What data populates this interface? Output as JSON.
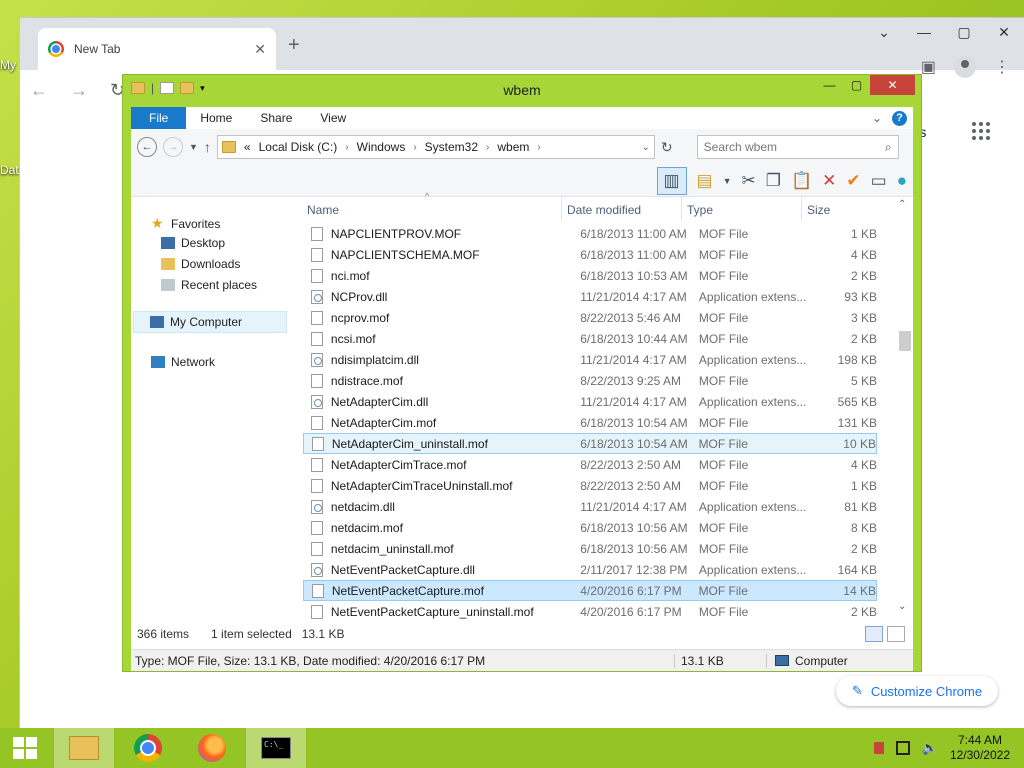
{
  "desktop": {
    "label1": "My",
    "label2": "Dat"
  },
  "chrome": {
    "tab_title": "New Tab",
    "page_text_partial": "ages",
    "customize_label": "Customize Chrome"
  },
  "explorer": {
    "title": "wbem",
    "ribbon_tabs": [
      "File",
      "Home",
      "Share",
      "View"
    ],
    "breadcrumb": [
      "«",
      "Local Disk (C:)",
      "Windows",
      "System32",
      "wbem"
    ],
    "search_placeholder": "Search wbem",
    "nav": {
      "favorites": "Favorites",
      "desktop": "Desktop",
      "downloads": "Downloads",
      "recent": "Recent places",
      "computer": "My Computer",
      "network": "Network"
    },
    "columns": {
      "name": "Name",
      "date": "Date modified",
      "type": "Type",
      "size": "Size"
    },
    "files": [
      {
        "name": "NAPCLIENTPROV.MOF",
        "date": "6/18/2013 11:00 AM",
        "type": "MOF File",
        "size": "1 KB",
        "kind": "mof"
      },
      {
        "name": "NAPCLIENTSCHEMA.MOF",
        "date": "6/18/2013 11:00 AM",
        "type": "MOF File",
        "size": "4 KB",
        "kind": "mof"
      },
      {
        "name": "nci.mof",
        "date": "6/18/2013 10:53 AM",
        "type": "MOF File",
        "size": "2 KB",
        "kind": "mof"
      },
      {
        "name": "NCProv.dll",
        "date": "11/21/2014 4:17 AM",
        "type": "Application extens...",
        "size": "93 KB",
        "kind": "dll"
      },
      {
        "name": "ncprov.mof",
        "date": "8/22/2013 5:46 AM",
        "type": "MOF File",
        "size": "3 KB",
        "kind": "mof"
      },
      {
        "name": "ncsi.mof",
        "date": "6/18/2013 10:44 AM",
        "type": "MOF File",
        "size": "2 KB",
        "kind": "mof"
      },
      {
        "name": "ndisimplatcim.dll",
        "date": "11/21/2014 4:17 AM",
        "type": "Application extens...",
        "size": "198 KB",
        "kind": "dll"
      },
      {
        "name": "ndistrace.mof",
        "date": "8/22/2013 9:25 AM",
        "type": "MOF File",
        "size": "5 KB",
        "kind": "mof"
      },
      {
        "name": "NetAdapterCim.dll",
        "date": "11/21/2014 4:17 AM",
        "type": "Application extens...",
        "size": "565 KB",
        "kind": "dll"
      },
      {
        "name": "NetAdapterCim.mof",
        "date": "6/18/2013 10:54 AM",
        "type": "MOF File",
        "size": "131 KB",
        "kind": "mof"
      },
      {
        "name": "NetAdapterCim_uninstall.mof",
        "date": "6/18/2013 10:54 AM",
        "type": "MOF File",
        "size": "10 KB",
        "kind": "mof",
        "hover": true
      },
      {
        "name": "NetAdapterCimTrace.mof",
        "date": "8/22/2013 2:50 AM",
        "type": "MOF File",
        "size": "4 KB",
        "kind": "mof"
      },
      {
        "name": "NetAdapterCimTraceUninstall.mof",
        "date": "8/22/2013 2:50 AM",
        "type": "MOF File",
        "size": "1 KB",
        "kind": "mof"
      },
      {
        "name": "netdacim.dll",
        "date": "11/21/2014 4:17 AM",
        "type": "Application extens...",
        "size": "81 KB",
        "kind": "dll"
      },
      {
        "name": "netdacim.mof",
        "date": "6/18/2013 10:56 AM",
        "type": "MOF File",
        "size": "8 KB",
        "kind": "mof"
      },
      {
        "name": "netdacim_uninstall.mof",
        "date": "6/18/2013 10:56 AM",
        "type": "MOF File",
        "size": "2 KB",
        "kind": "mof"
      },
      {
        "name": "NetEventPacketCapture.dll",
        "date": "2/11/2017 12:38 PM",
        "type": "Application extens...",
        "size": "164 KB",
        "kind": "dll"
      },
      {
        "name": "NetEventPacketCapture.mof",
        "date": "4/20/2016 6:17 PM",
        "type": "MOF File",
        "size": "14 KB",
        "kind": "mof",
        "selected": true
      },
      {
        "name": "NetEventPacketCapture_uninstall.mof",
        "date": "4/20/2016 6:17 PM",
        "type": "MOF File",
        "size": "2 KB",
        "kind": "mof"
      }
    ],
    "status_count": "366 items",
    "status_selected": "1 item selected",
    "status_size": "13.1 KB",
    "detail_info": "Type: MOF File, Size: 13.1 KB, Date modified: 4/20/2016 6:17 PM",
    "detail_size": "13.1 KB",
    "detail_location": "Computer"
  },
  "taskbar": {
    "time": "7:44 AM",
    "date": "12/30/2022"
  }
}
